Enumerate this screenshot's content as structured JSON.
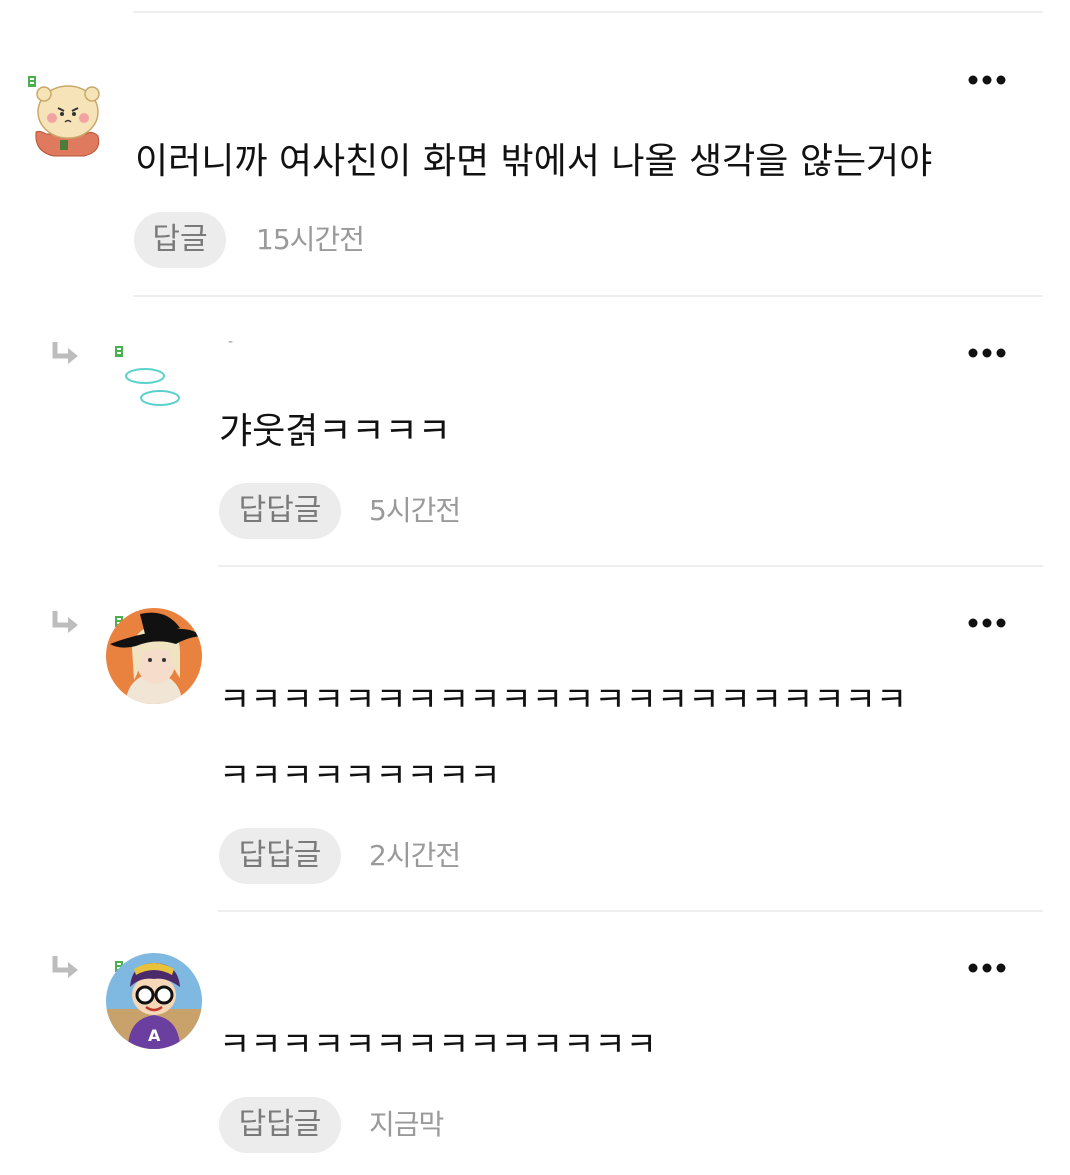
{
  "colors": {
    "divider": "#eeeeee",
    "reply_button_bg": "#ececec",
    "reply_button_text": "#7a7a7a",
    "timestamp": "#9a9a9a",
    "badge_green": "#4caf50",
    "reply_arrow": "#bdbdbd"
  },
  "comments": [
    {
      "level_badge_icon": "level-badge-icon",
      "avatar_icon": "bear-sticker-avatar",
      "text": "이러니까 여사친이 화면 밖에서 나올 생각을 않는거야",
      "reply_label": "답글",
      "time": "15시간전"
    },
    {
      "reply_icon": "reply-arrow-icon",
      "level_badge_icon": "level-badge-icon",
      "avatar_icon": "cyan-ring-avatar",
      "nickname": "-",
      "text": "갸웃겱ㅋㅋㅋㅋ",
      "reply_label": "답답글",
      "time": "5시간전"
    },
    {
      "reply_icon": "reply-arrow-icon",
      "level_badge_icon": "level-badge-icon",
      "avatar_icon": "photo-avatar-hat",
      "text_line1": "ㅋㅋㅋㅋㅋㅋㅋㅋㅋㅋㅋㅋㅋㅋㅋㅋㅋㅋㅋㅋㅋㅋ",
      "text_line2": "ㅋㅋㅋㅋㅋㅋㅋㅋㅋ",
      "reply_label": "답답글",
      "time": "2시간전"
    },
    {
      "reply_icon": "reply-arrow-icon",
      "level_badge_icon": "level-badge-icon",
      "avatar_icon": "cartoon-girl-avatar",
      "text": "ㅋㅋㅋㅋㅋㅋㅋㅋㅋㅋㅋㅋㅋㅋ",
      "reply_label": "답답글",
      "time": "지금막"
    }
  ]
}
